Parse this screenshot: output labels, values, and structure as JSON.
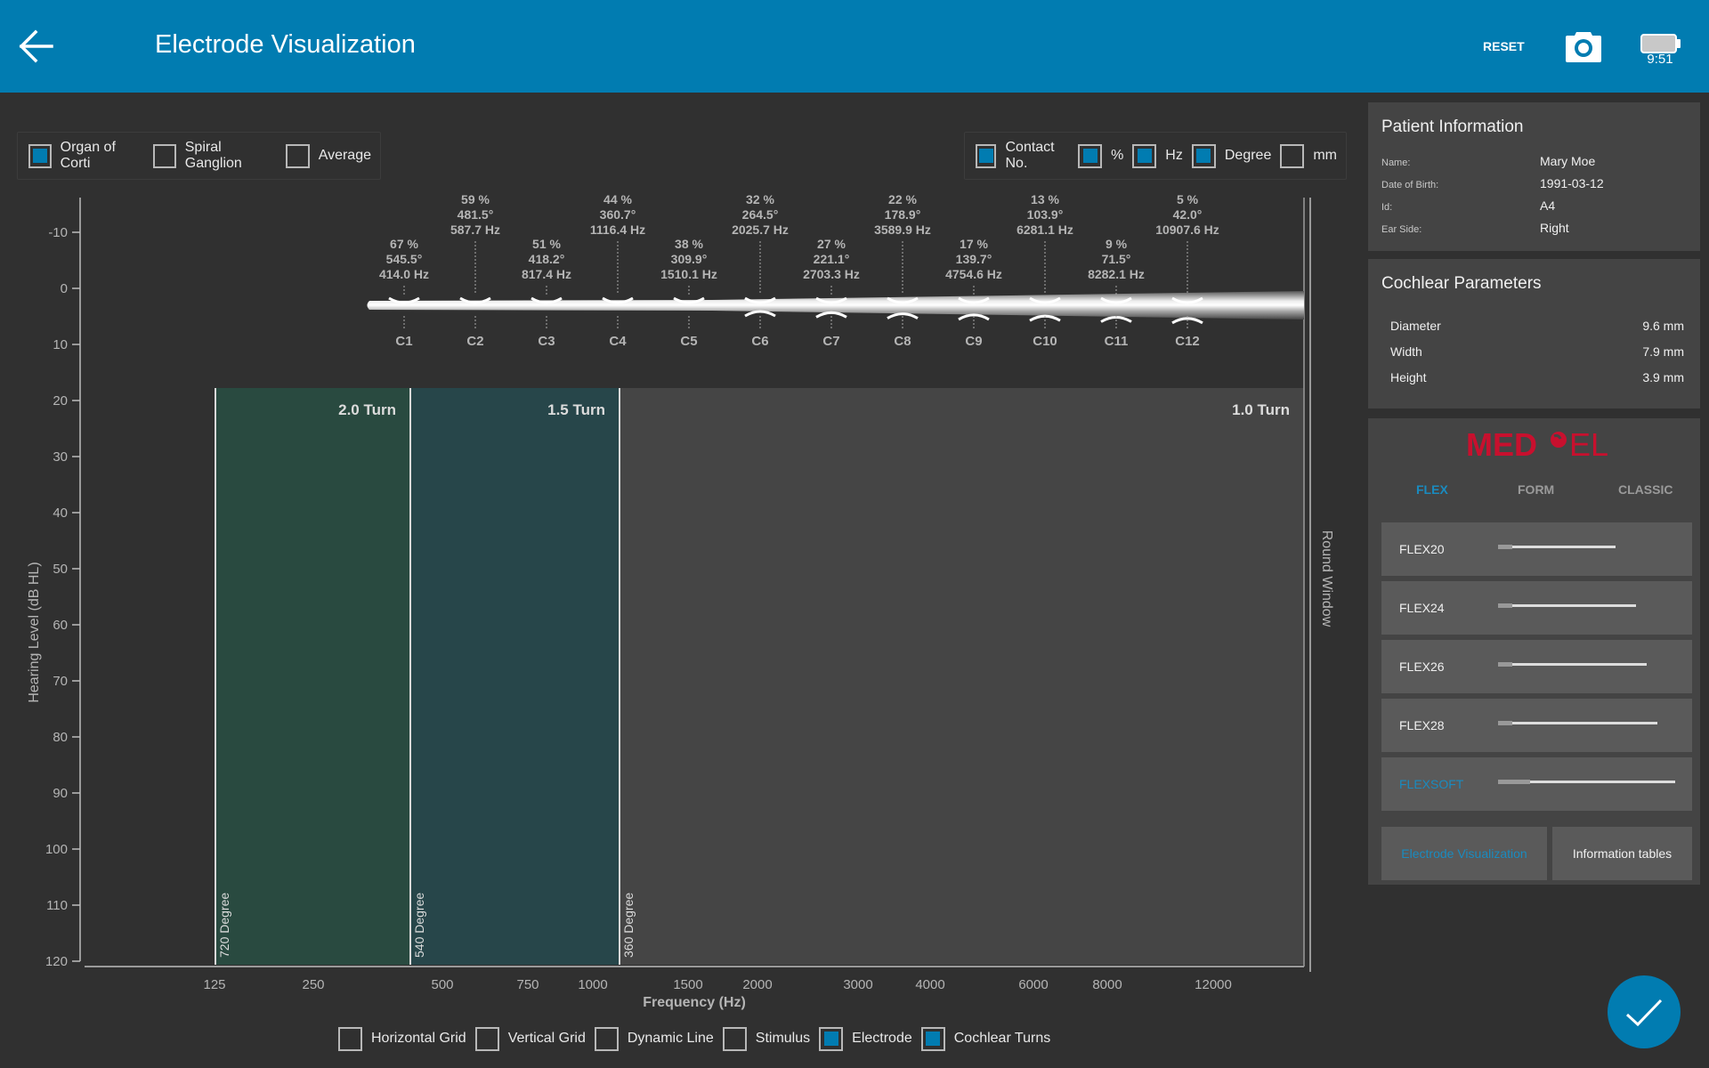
{
  "header": {
    "title": "Electrode Visualization",
    "reset_label": "RESET",
    "clock": "9:51",
    "colors": {
      "bar": "#017cb1"
    }
  },
  "icons": {
    "back": "arrow-left-icon",
    "camera": "camera-icon",
    "battery": "battery-icon",
    "confirm": "checkmark-icon"
  },
  "location_options": [
    {
      "label": "Organ of Corti",
      "checked": true
    },
    {
      "label": "Spiral Ganglion",
      "checked": false
    },
    {
      "label": "Average",
      "checked": false
    }
  ],
  "label_options": [
    {
      "label": "Contact No.",
      "checked": true
    },
    {
      "label": "%",
      "checked": true
    },
    {
      "label": "Hz",
      "checked": true
    },
    {
      "label": "Degree",
      "checked": true
    },
    {
      "label": "mm",
      "checked": false
    }
  ],
  "display_options": [
    {
      "label": "Horizontal Grid",
      "checked": false
    },
    {
      "label": "Vertical Grid",
      "checked": false
    },
    {
      "label": "Dynamic Line",
      "checked": false
    },
    {
      "label": "Stimulus",
      "checked": false
    },
    {
      "label": "Electrode",
      "checked": true
    },
    {
      "label": "Cochlear Turns",
      "checked": true
    }
  ],
  "chart_data": {
    "type": "scatter",
    "xlabel": "Frequency (Hz)",
    "ylabel": "Hearing Level (dB HL)",
    "x_ticks": [
      "125",
      "250",
      "500",
      "750",
      "1000",
      "1500",
      "2000",
      "3000",
      "4000",
      "6000",
      "8000",
      "12000"
    ],
    "y_ticks": [
      "-10",
      "0",
      "10",
      "20",
      "30",
      "40",
      "50",
      "60",
      "70",
      "80",
      "90",
      "100",
      "110",
      "120"
    ],
    "ylim": [
      -15,
      120
    ],
    "grid": false,
    "round_window_label": "Round Window",
    "turns": [
      {
        "label": "2.0 Turn",
        "boundary_label": "720 Degree",
        "color": "#294a40"
      },
      {
        "label": "1.5 Turn",
        "boundary_label": "540 Degree",
        "color": "#27464a"
      },
      {
        "label": "1.0 Turn",
        "boundary_label": "360 Degree",
        "color": "#454545"
      }
    ],
    "contacts": [
      {
        "name": "C1",
        "percent": "67 %",
        "degree": "545.5°",
        "freq": "414.0 Hz"
      },
      {
        "name": "C2",
        "percent": "59 %",
        "degree": "481.5°",
        "freq": "587.7 Hz"
      },
      {
        "name": "C3",
        "percent": "51 %",
        "degree": "418.2°",
        "freq": "817.4 Hz"
      },
      {
        "name": "C4",
        "percent": "44 %",
        "degree": "360.7°",
        "freq": "1116.4 Hz"
      },
      {
        "name": "C5",
        "percent": "38 %",
        "degree": "309.9°",
        "freq": "1510.1 Hz"
      },
      {
        "name": "C6",
        "percent": "32 %",
        "degree": "264.5°",
        "freq": "2025.7 Hz"
      },
      {
        "name": "C7",
        "percent": "27 %",
        "degree": "221.1°",
        "freq": "2703.3 Hz"
      },
      {
        "name": "C8",
        "percent": "22 %",
        "degree": "178.9°",
        "freq": "3589.9 Hz"
      },
      {
        "name": "C9",
        "percent": "17 %",
        "degree": "139.7°",
        "freq": "4754.6 Hz"
      },
      {
        "name": "C10",
        "percent": "13 %",
        "degree": "103.9°",
        "freq": "6281.1 Hz"
      },
      {
        "name": "C11",
        "percent": "9 %",
        "degree": "71.5°",
        "freq": "8282.1 Hz"
      },
      {
        "name": "C12",
        "percent": "5 %",
        "degree": "42.0°",
        "freq": "10907.6 Hz"
      }
    ]
  },
  "patient_info": {
    "title": "Patient Information",
    "rows": [
      {
        "label": "Name:",
        "value": "Mary Moe"
      },
      {
        "label": "Date of Birth:",
        "value": "1991-03-12"
      },
      {
        "label": "Id:",
        "value": "A4"
      },
      {
        "label": "Ear Side:",
        "value": "Right"
      }
    ]
  },
  "cochlear_params": {
    "title": "Cochlear Parameters",
    "rows": [
      {
        "label": "Diameter",
        "value": "9.6 mm"
      },
      {
        "label": "Width",
        "value": "7.9 mm"
      },
      {
        "label": "Height",
        "value": "3.9 mm"
      }
    ]
  },
  "electrode_panel": {
    "brand_left": "MED",
    "brand_right": "EL",
    "brand_color": "#c8102e",
    "accent_color": "#1a8bbf",
    "series_tabs": [
      {
        "label": "FLEX",
        "active": true
      },
      {
        "label": "FORM",
        "active": false
      },
      {
        "label": "CLASSIC",
        "active": false
      }
    ],
    "models": [
      {
        "name": "FLEX20",
        "active": false
      },
      {
        "name": "FLEX24",
        "active": false
      },
      {
        "name": "FLEX26",
        "active": false
      },
      {
        "name": "FLEX28",
        "active": false
      },
      {
        "name": "FLEXSOFT",
        "active": true
      }
    ],
    "nav": [
      {
        "label": "Electrode Visualization",
        "active": true
      },
      {
        "label": "Information tables",
        "active": false
      }
    ]
  }
}
